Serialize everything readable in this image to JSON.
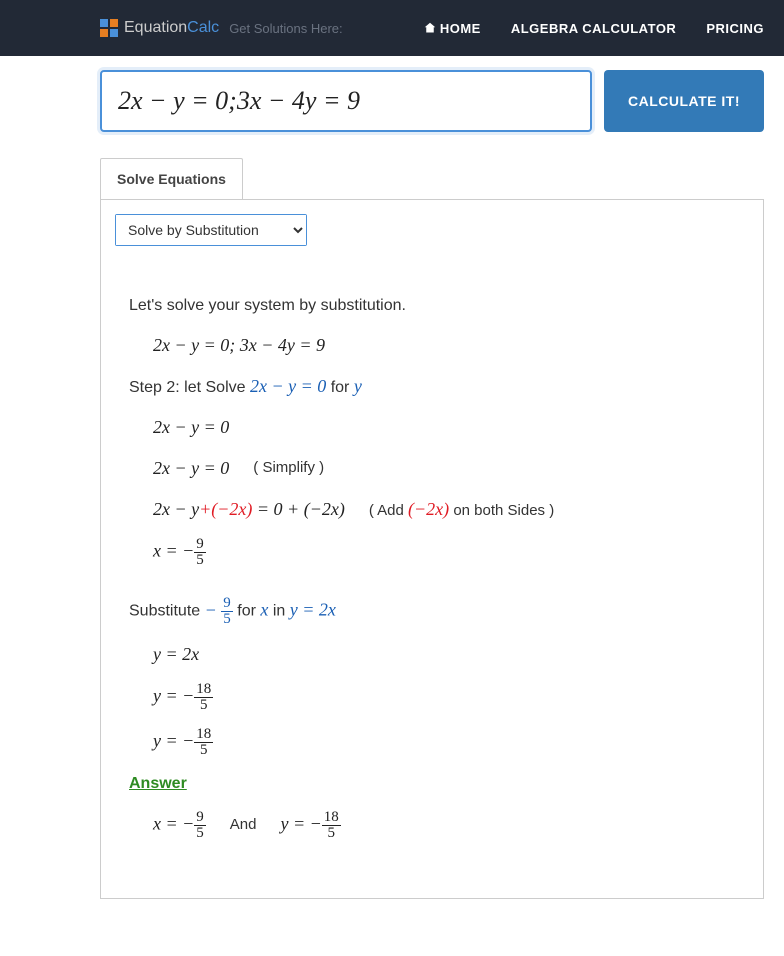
{
  "nav": {
    "logo_part1": "Equation",
    "logo_part2": "Calc",
    "tagline": "Get Solutions Here:",
    "home": "HOME",
    "algebra": "ALGEBRA CALCULATOR",
    "pricing": "PRICING"
  },
  "input": {
    "value": "2x − y = 0;3x − 4y = 9",
    "button": "CALCULATE IT!"
  },
  "tabs": {
    "solve": "Solve Equations"
  },
  "method": {
    "selected": "Solve by Substitution"
  },
  "sol": {
    "intro": "Let's solve your system by substitution.",
    "system": "2x − y = 0;   3x − 4y = 9",
    "step2_a": "Step 2: let Solve ",
    "step2_eq": "2x − y = 0",
    "step2_for": " for ",
    "step2_var": "y",
    "l1": "2x − y = 0",
    "l2a": "2x − y = 0",
    "l2b": "( Simplify )",
    "l3a": "2x − y",
    "l3red": "+(−2x)",
    "l3b": " = 0 + (−2x)",
    "l3note_a": "( Add  ",
    "l3note_red": "(−2x)",
    "l3note_b": "  on both Sides )",
    "l4a": "x = −",
    "l4num": "9",
    "l4den": "5",
    "sub_a": "Substitute ",
    "sub_sign": "− ",
    "sub_num": "9",
    "sub_den": "5",
    "sub_for": " for ",
    "sub_x": "x",
    "sub_in": " in ",
    "sub_eq": "y = 2x",
    "s1": "y = 2x",
    "s2a": "y = −",
    "s2num": "18",
    "s2den": "5",
    "s3a": "y = −",
    "s3num": "18",
    "s3den": "5",
    "answer_label": "Answer",
    "ans_x_a": "x = −",
    "ans_x_num": "9",
    "ans_x_den": "5",
    "ans_and": "And",
    "ans_y_a": "y = −",
    "ans_y_num": "18",
    "ans_y_den": "5"
  }
}
